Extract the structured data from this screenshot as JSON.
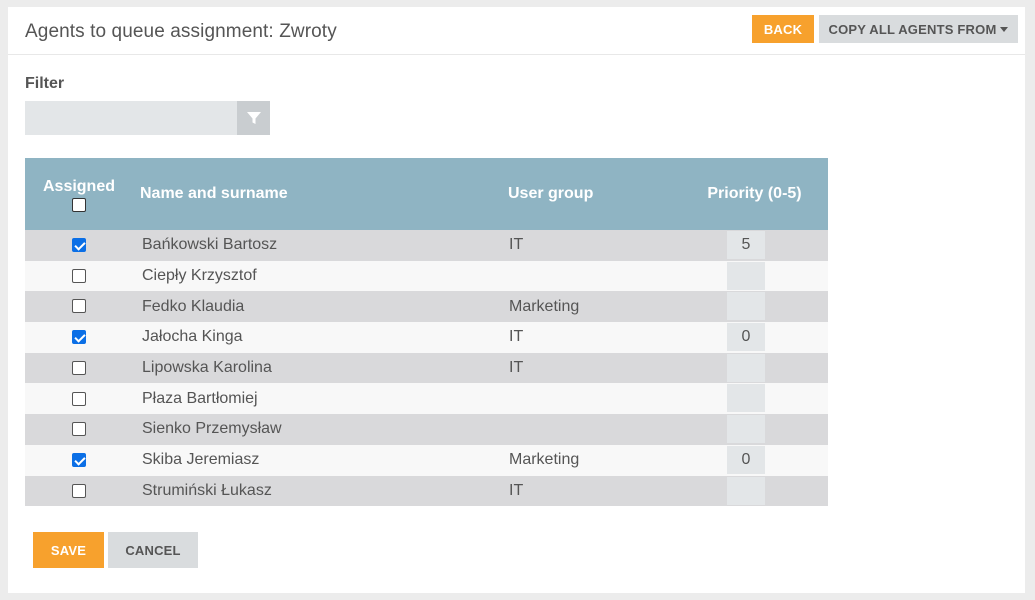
{
  "header": {
    "title": "Agents to queue assignment: Zwroty",
    "back_label": "BACK",
    "copy_label": "COPY ALL AGENTS FROM"
  },
  "filter": {
    "label": "Filter",
    "value": "",
    "icon": "filter-funnel-icon"
  },
  "table": {
    "columns": [
      "Assigned",
      "Name and surname",
      "User group",
      "Priority (0-5)"
    ],
    "header_checkbox_checked": false,
    "rows": [
      {
        "assigned": true,
        "name": "Bańkowski Bartosz",
        "group": "IT",
        "priority": "5"
      },
      {
        "assigned": false,
        "name": "Ciepły Krzysztof",
        "group": "",
        "priority": ""
      },
      {
        "assigned": false,
        "name": "Fedko Klaudia",
        "group": "Marketing",
        "priority": ""
      },
      {
        "assigned": true,
        "name": "Jałocha Kinga",
        "group": "IT",
        "priority": "0"
      },
      {
        "assigned": false,
        "name": "Lipowska Karolina",
        "group": "IT",
        "priority": ""
      },
      {
        "assigned": false,
        "name": "Płaza Bartłomiej",
        "group": "",
        "priority": ""
      },
      {
        "assigned": false,
        "name": "Sienko Przemysław",
        "group": "",
        "priority": ""
      },
      {
        "assigned": true,
        "name": "Skiba Jeremiasz",
        "group": "Marketing",
        "priority": "0"
      },
      {
        "assigned": false,
        "name": "Strumiński Łukasz",
        "group": "IT",
        "priority": ""
      }
    ]
  },
  "footer": {
    "save_label": "SAVE",
    "cancel_label": "CANCEL"
  },
  "colors": {
    "accent": "#f7a12d",
    "table_header": "#8fb4c3",
    "checkbox_checked": "#0b6fe6"
  }
}
